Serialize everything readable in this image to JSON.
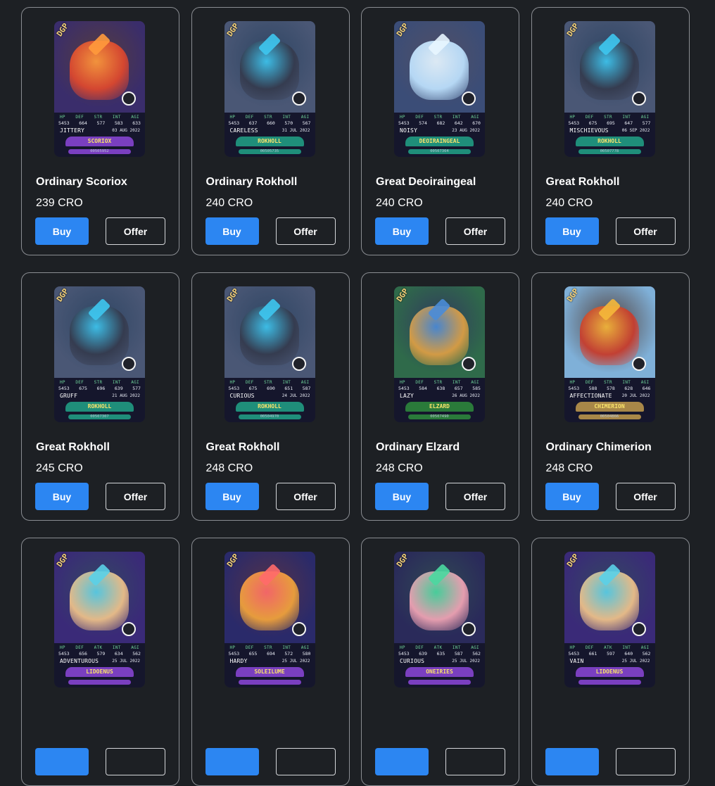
{
  "listings": [
    {
      "name": "Ordinary Scoriox",
      "price": "239 CRO",
      "buy_label": "Buy",
      "offer_label": "Offer",
      "card": {
        "badge": "DGP",
        "stat_labels": [
          "HP",
          "DEF",
          "STR",
          "INT",
          "AGI"
        ],
        "stats": [
          "5453",
          "664",
          "577",
          "583",
          "633"
        ],
        "trait": "JITTERY",
        "mint_date": "03 AUG 2022",
        "species": "SCORIOX",
        "serial": "00505952",
        "theme": {
          "bg": "#3a2d6b",
          "creature": "#e0482d",
          "accent": "#ff9a3c",
          "banner": "#7a3fc0"
        }
      }
    },
    {
      "name": "Ordinary Rokholl",
      "price": "240 CRO",
      "buy_label": "Buy",
      "offer_label": "Offer",
      "card": {
        "badge": "DGP",
        "stat_labels": [
          "HP",
          "DEF",
          "STR",
          "INT",
          "AGI"
        ],
        "stats": [
          "5453",
          "637",
          "660",
          "570",
          "567"
        ],
        "trait": "CARELESS",
        "mint_date": "31 JUL 2022",
        "species": "ROKHOLL",
        "serial": "00505735",
        "theme": {
          "bg": "#4a5775",
          "creature": "#343a4d",
          "accent": "#3ec6f0",
          "banner": "#1f8e7a"
        }
      }
    },
    {
      "name": "Great Deoiraingeal",
      "price": "240 CRO",
      "buy_label": "Buy",
      "offer_label": "Offer",
      "card": {
        "badge": "DGP",
        "stat_labels": [
          "HP",
          "DEF",
          "STR",
          "INT",
          "AGI"
        ],
        "stats": [
          "5453",
          "574",
          "682",
          "642",
          "670"
        ],
        "trait": "NOISY",
        "mint_date": "23 AUG 2022",
        "species": "DEOIRAINGEAL",
        "serial": "00507364",
        "theme": {
          "bg": "#3b4d77",
          "creature": "#bfe3ff",
          "accent": "#e8f6ff",
          "banner": "#1f8e7a"
        }
      }
    },
    {
      "name": "Great Rokholl",
      "price": "240 CRO",
      "buy_label": "Buy",
      "offer_label": "Offer",
      "card": {
        "badge": "DGP",
        "stat_labels": [
          "HP",
          "DEF",
          "STR",
          "INT",
          "AGI"
        ],
        "stats": [
          "5453",
          "675",
          "695",
          "647",
          "577"
        ],
        "trait": "MISCHIEVOUS",
        "mint_date": "06 SEP 2022",
        "species": "ROKHOLL",
        "serial": "00507778",
        "theme": {
          "bg": "#4a5775",
          "creature": "#343a4d",
          "accent": "#3ec6f0",
          "banner": "#1f8e7a"
        }
      }
    },
    {
      "name": "Great Rokholl",
      "price": "245 CRO",
      "buy_label": "Buy",
      "offer_label": "Offer",
      "card": {
        "badge": "DGP",
        "stat_labels": [
          "HP",
          "DEF",
          "STR",
          "INT",
          "AGI"
        ],
        "stats": [
          "5453",
          "675",
          "696",
          "639",
          "577"
        ],
        "trait": "GRUFF",
        "mint_date": "21 AUG 2022",
        "species": "ROKHOLL",
        "serial": "00507307",
        "theme": {
          "bg": "#4a5775",
          "creature": "#343a4d",
          "accent": "#3ec6f0",
          "banner": "#1f8e7a"
        }
      }
    },
    {
      "name": "Great Rokholl",
      "price": "248 CRO",
      "buy_label": "Buy",
      "offer_label": "Offer",
      "card": {
        "badge": "DGP",
        "stat_labels": [
          "HP",
          "DEF",
          "STR",
          "INT",
          "AGI"
        ],
        "stats": [
          "5453",
          "675",
          "690",
          "651",
          "587"
        ],
        "trait": "CURIOUS",
        "mint_date": "24 JUL 2022",
        "species": "ROKHOLL",
        "serial": "00504970",
        "theme": {
          "bg": "#4a5775",
          "creature": "#343a4d",
          "accent": "#3ec6f0",
          "banner": "#1f8e7a"
        }
      }
    },
    {
      "name": "Ordinary Elzard",
      "price": "248 CRO",
      "buy_label": "Buy",
      "offer_label": "Offer",
      "card": {
        "badge": "DGP",
        "stat_labels": [
          "HP",
          "DEF",
          "STR",
          "INT",
          "AGI"
        ],
        "stats": [
          "5453",
          "584",
          "638",
          "657",
          "585"
        ],
        "trait": "LAZY",
        "mint_date": "26 AUG 2022",
        "species": "ELZARD",
        "serial": "00507490",
        "theme": {
          "bg": "#2f6a4a",
          "creature": "#e0a044",
          "accent": "#4a8cd8",
          "banner": "#2a7a3a"
        }
      }
    },
    {
      "name": "Ordinary Chimerion",
      "price": "248 CRO",
      "buy_label": "Buy",
      "offer_label": "Offer",
      "card": {
        "badge": "DGP",
        "stat_labels": [
          "HP",
          "DEF",
          "STR",
          "INT",
          "AGI"
        ],
        "stats": [
          "5453",
          "588",
          "578",
          "628",
          "646"
        ],
        "trait": "AFFECTIONATE",
        "mint_date": "20 JUL 2022",
        "species": "CHIMERION",
        "serial": "00504866",
        "theme": {
          "bg": "#7fb0d8",
          "creature": "#c93a2a",
          "accent": "#f5b83a",
          "banner": "#a88748"
        }
      }
    },
    {
      "name": "",
      "price": "",
      "buy_label": "",
      "offer_label": "",
      "card": {
        "badge": "DGP",
        "stat_labels": [
          "HP",
          "DEF",
          "ATK",
          "INT",
          "AGI"
        ],
        "stats": [
          "5453",
          "656",
          "579",
          "634",
          "562"
        ],
        "trait": "ADVENTUROUS",
        "mint_date": "25 JUL 2022",
        "species": "LIDOENUS",
        "serial": "",
        "theme": {
          "bg": "#3a2a78",
          "creature": "#f2c48a",
          "accent": "#5ad0e8",
          "banner": "#7a3fc0"
        }
      }
    },
    {
      "name": "",
      "price": "",
      "buy_label": "",
      "offer_label": "",
      "card": {
        "badge": "DGP",
        "stat_labels": [
          "HP",
          "DEF",
          "STR",
          "INT",
          "AGI"
        ],
        "stats": [
          "5453",
          "655",
          "694",
          "572",
          "580"
        ],
        "trait": "HARDY",
        "mint_date": "25 JUL 2022",
        "species": "SOLEILUME",
        "serial": "",
        "theme": {
          "bg": "#2a2a6a",
          "creature": "#f5a53a",
          "accent": "#ff6a6a",
          "banner": "#7a3fc0"
        }
      }
    },
    {
      "name": "",
      "price": "",
      "buy_label": "",
      "offer_label": "",
      "card": {
        "badge": "DGP",
        "stat_labels": [
          "HP",
          "DEF",
          "ATK",
          "INT",
          "AGI"
        ],
        "stats": [
          "5453",
          "639",
          "635",
          "587",
          "562"
        ],
        "trait": "CURIOUS",
        "mint_date": "25 JUL 2022",
        "species": "ONEIRIES",
        "serial": "",
        "theme": {
          "bg": "#2a2a5a",
          "creature": "#f4a6b6",
          "accent": "#4ad8a0",
          "banner": "#7a3fc0"
        }
      }
    },
    {
      "name": "",
      "price": "",
      "buy_label": "",
      "offer_label": "",
      "card": {
        "badge": "DGP",
        "stat_labels": [
          "HP",
          "DEF",
          "ATK",
          "INT",
          "AGI"
        ],
        "stats": [
          "5453",
          "661",
          "597",
          "640",
          "562"
        ],
        "trait": "VAIN",
        "mint_date": "25 JUL 2022",
        "species": "LIDOENUS",
        "serial": "",
        "theme": {
          "bg": "#3a2a78",
          "creature": "#f2c48a",
          "accent": "#5ad0e8",
          "banner": "#7a3fc0"
        }
      }
    }
  ]
}
